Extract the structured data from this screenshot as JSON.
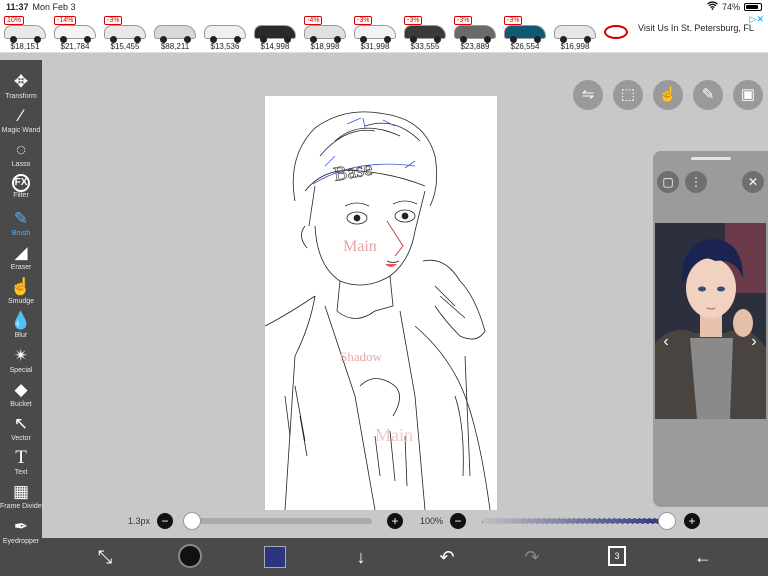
{
  "status_bar": {
    "time": "11:37",
    "date": "Mon Feb 3",
    "battery": "74%",
    "battery_level": 0.74
  },
  "ad": {
    "cars": [
      {
        "badge": "10%",
        "price": "$18,151",
        "color": "#e8e8e8"
      },
      {
        "badge": "-14%",
        "price": "$21,784",
        "color": "#f4f4f4"
      },
      {
        "badge": "-3%",
        "price": "$15,455",
        "color": "#e8e8e8"
      },
      {
        "badge": "",
        "price": "$88,211",
        "color": "#d8d8d8"
      },
      {
        "badge": "",
        "price": "$13,536",
        "color": "#efefef"
      },
      {
        "badge": "",
        "price": "$14,998",
        "color": "#2a2a2a"
      },
      {
        "badge": "-4%",
        "price": "$18,998",
        "color": "#e0e0e0"
      },
      {
        "badge": "-3%",
        "price": "$31,998",
        "color": "#f2f2f2"
      },
      {
        "badge": "-3%",
        "price": "$33,555",
        "color": "#3a3a3a"
      },
      {
        "badge": "-3%",
        "price": "$23,889",
        "color": "#6a6a6a"
      },
      {
        "badge": "-3%",
        "price": "$26,554",
        "color": "#0f5a70"
      },
      {
        "badge": "",
        "price": "$16,998",
        "color": "#e6e6e6"
      }
    ],
    "text": "Visit Us In St. Petersburg, FL"
  },
  "tools": [
    {
      "label": "Transform",
      "icon": "move-arrows-icon",
      "glyph": "✥",
      "name": "tool-transform"
    },
    {
      "label": "Magic Wand",
      "icon": "magic-wand-icon",
      "glyph": "⁄",
      "name": "tool-magic-wand"
    },
    {
      "label": "Lasso",
      "icon": "lasso-icon",
      "glyph": "◌",
      "name": "tool-lasso"
    },
    {
      "label": "Filter",
      "icon": "fx-icon",
      "glyph": "FX",
      "name": "tool-filter"
    },
    {
      "label": "Brush",
      "icon": "brush-icon",
      "glyph": "✎",
      "name": "tool-brush",
      "active": true
    },
    {
      "label": "Eraser",
      "icon": "eraser-icon",
      "glyph": "◢",
      "name": "tool-eraser"
    },
    {
      "label": "Smudge",
      "icon": "smudge-icon",
      "glyph": "☝",
      "name": "tool-smudge"
    },
    {
      "label": "Blur",
      "icon": "blur-drop-icon",
      "glyph": "💧",
      "name": "tool-blur"
    },
    {
      "label": "Special",
      "icon": "sparkle-wand-icon",
      "glyph": "✴",
      "name": "tool-special"
    },
    {
      "label": "Bucket",
      "icon": "bucket-icon",
      "glyph": "◆",
      "name": "tool-bucket"
    },
    {
      "label": "Vector",
      "icon": "vector-arrow-icon",
      "glyph": "↖",
      "name": "tool-vector"
    },
    {
      "label": "Text",
      "icon": "text-icon",
      "glyph": "T",
      "name": "tool-text"
    },
    {
      "label": "Frame Divider",
      "icon": "frame-divider-icon",
      "glyph": "▦",
      "name": "tool-frame-divider"
    },
    {
      "label": "Eyedropper",
      "icon": "eyedropper-icon",
      "glyph": "✒",
      "name": "tool-eyedropper"
    }
  ],
  "sliders": {
    "brush_size_label": "1.3px",
    "brush_size_level": 0,
    "opacity_label": "100%",
    "opacity_level": 1,
    "minus": "−",
    "plus": "+"
  },
  "bottom_toolbar": {
    "brush_color": "#111111",
    "secondary_color": "#2d3480",
    "layer_count": "3"
  },
  "reference_panel": {
    "icons": [
      "layer-square-icon",
      "more-icon",
      "close-icon"
    ]
  },
  "colors": {
    "accent": "#4fb3ff",
    "toolbar_bg": "#4a4a4a",
    "workspace_bg": "#c8c8c8"
  }
}
